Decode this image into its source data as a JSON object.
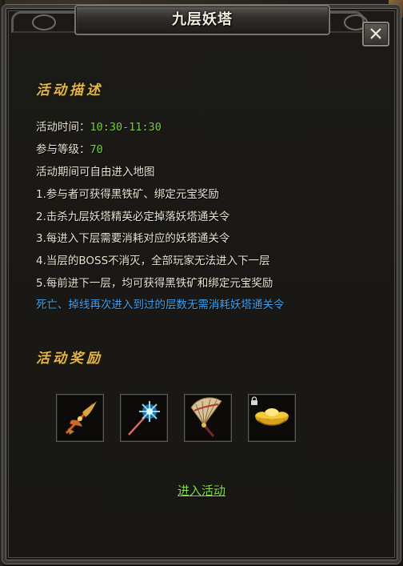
{
  "window": {
    "title": "九层妖塔"
  },
  "description": {
    "heading": "活动描述",
    "time_label": "活动时间：",
    "time_value": "10:30-11:30",
    "level_label": "参与等级：",
    "level_value": "70",
    "free_entry": "活动期间可自由进入地图",
    "rules": [
      "1.参与者可获得黑铁矿、绑定元宝奖励",
      "2.击杀九层妖塔精英必定掉落妖塔通关令",
      "3.每进入下层需要消耗对应的妖塔通关令",
      "4.当层的BOSS不消灭，全部玩家无法进入下一层",
      "5.每前进下一层，均可获得黑铁矿和绑定元宝奖励"
    ],
    "highlight_note": "死亡、掉线再次进入到过的层数无需消耗妖塔通关令"
  },
  "rewards": {
    "heading": "活动奖励",
    "items": [
      {
        "icon": "flame-spear-icon"
      },
      {
        "icon": "crystal-staff-icon"
      },
      {
        "icon": "war-fan-icon"
      },
      {
        "icon": "gold-ingot-icon",
        "bound": true
      }
    ]
  },
  "actions": {
    "enter_label": "进入活动"
  },
  "colors": {
    "heading_gold": "#e2b94a",
    "value_green": "#7bd23a",
    "note_blue": "#3fa3f2",
    "link_green": "#7ee33a"
  }
}
